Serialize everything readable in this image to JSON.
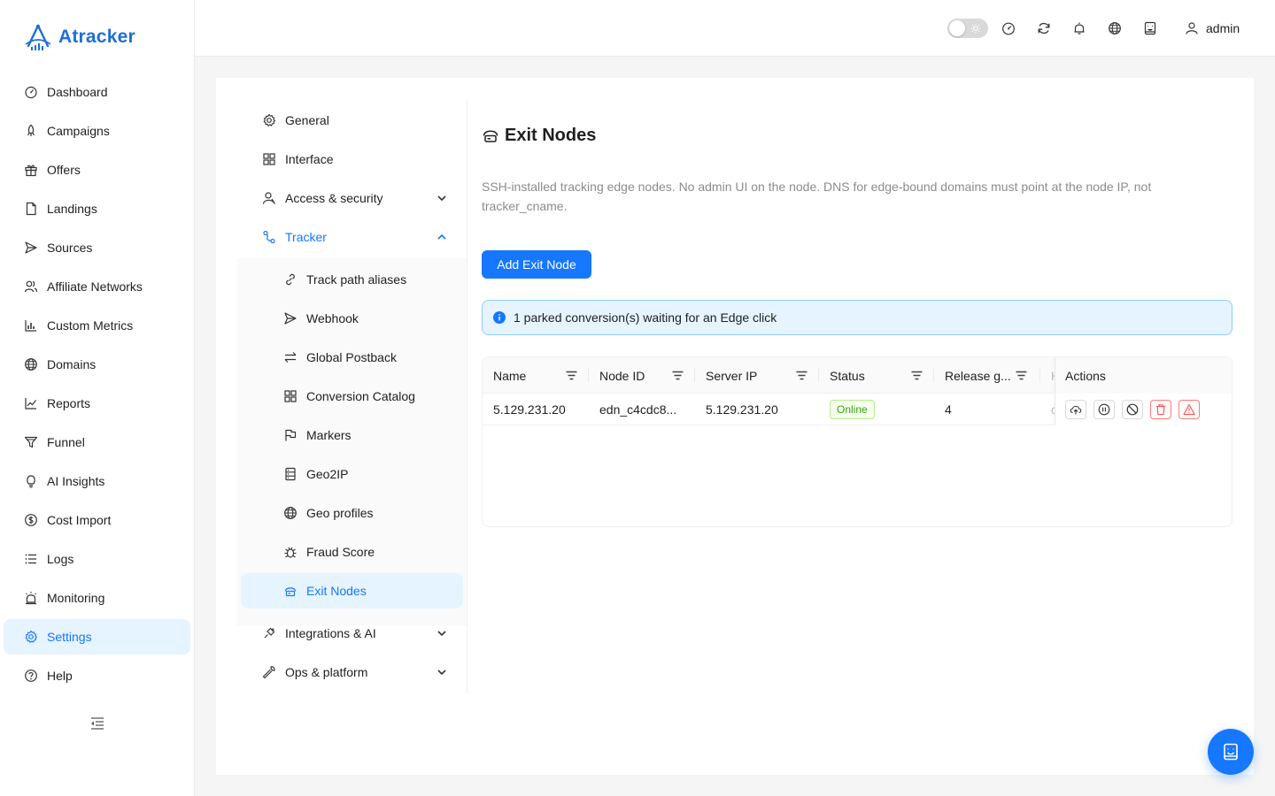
{
  "brand": {
    "name": "Atracker",
    "color": "#1f6fd6"
  },
  "sidebar": {
    "items": [
      {
        "label": "Dashboard",
        "icon": "dashboard-icon"
      },
      {
        "label": "Campaigns",
        "icon": "rocket-icon"
      },
      {
        "label": "Offers",
        "icon": "gift-icon"
      },
      {
        "label": "Landings",
        "icon": "file-icon"
      },
      {
        "label": "Sources",
        "icon": "send-icon"
      },
      {
        "label": "Affiliate Networks",
        "icon": "users-icon"
      },
      {
        "label": "Custom Metrics",
        "icon": "bar-chart-icon"
      },
      {
        "label": "Domains",
        "icon": "globe-icon"
      },
      {
        "label": "Reports",
        "icon": "line-chart-icon"
      },
      {
        "label": "Funnel",
        "icon": "funnel-icon"
      },
      {
        "label": "AI Insights",
        "icon": "bulb-icon"
      },
      {
        "label": "Cost Import",
        "icon": "dollar-icon"
      },
      {
        "label": "Logs",
        "icon": "list-icon"
      },
      {
        "label": "Monitoring",
        "icon": "alarm-icon"
      },
      {
        "label": "Settings",
        "icon": "gear-icon",
        "active": true
      },
      {
        "label": "Help",
        "icon": "question-icon"
      }
    ]
  },
  "header": {
    "user": "admin",
    "theme_toggle": "light"
  },
  "settings_menu": {
    "general": "General",
    "interface": "Interface",
    "access_security": "Access & security",
    "tracker": "Tracker",
    "tracker_items": [
      "Track path aliases",
      "Webhook",
      "Global Postback",
      "Conversion Catalog",
      "Markers",
      "Geo2IP",
      "Geo profiles",
      "Fraud Score",
      "Exit Nodes"
    ],
    "integrations_ai": "Integrations & AI",
    "ops_platform": "Ops & platform"
  },
  "page": {
    "title": "Exit Nodes",
    "description": "SSH-installed tracking edge nodes. No admin UI on the node. DNS for edge-bound domains must point at the node IP, not tracker_cname.",
    "add_button": "Add Exit Node",
    "alert": "1 parked conversion(s) waiting for an Edge click"
  },
  "table": {
    "columns": [
      "Name",
      "Node ID",
      "Server IP",
      "Status",
      "Release g...",
      "H",
      "Actions"
    ],
    "rows": [
      {
        "name": "5.129.231.20",
        "node_id": "edn_c4cdc8...",
        "server_ip": "5.129.231.20",
        "status": "Online",
        "release": "4",
        "h": "c"
      }
    ]
  },
  "colors": {
    "primary": "#1677ff",
    "success": "#389e0d",
    "danger": "#ff4d4f"
  }
}
